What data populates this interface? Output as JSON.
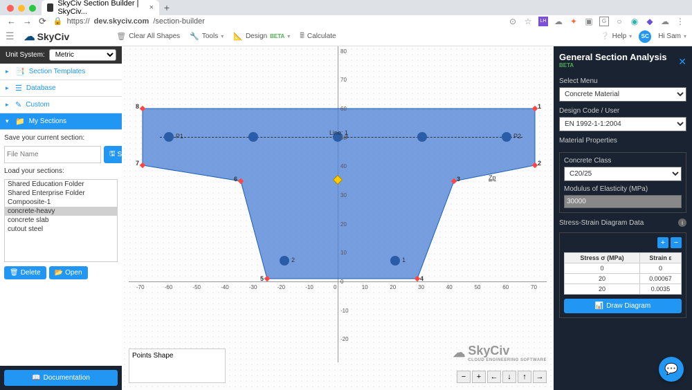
{
  "browser": {
    "tab_title": "SkyCiv Section Builder | SkyCiv...",
    "url_prefix": "https://",
    "url_host": "dev.skyciv.com",
    "url_path": "/section-builder"
  },
  "toolbar": {
    "logo": "SkyCiv",
    "clear": "Clear All Shapes",
    "tools": "Tools",
    "design": "Design",
    "beta": "BETA",
    "calculate": "Calculate",
    "help": "Help",
    "user_initials": "SC",
    "user_name": "Hi Sam"
  },
  "left": {
    "unit_label": "Unit System:",
    "unit_value": "Metric",
    "acc": [
      {
        "label": "Section Templates",
        "icon": "📑"
      },
      {
        "label": "Database",
        "icon": "☰"
      },
      {
        "label": "Custom",
        "icon": "✎"
      },
      {
        "label": "My Sections",
        "icon": "📁"
      }
    ],
    "save_label": "Save your current section:",
    "file_placeholder": "File Name",
    "save_btn": "Save",
    "load_label": "Load your sections:",
    "sections": [
      "Shared Education Folder",
      "Shared Enterprise Folder",
      "Compoosite-1",
      "concrete-heavy",
      "concrete slab",
      "cutout steel"
    ],
    "selected_section": "concrete-heavy",
    "delete_btn": "Delete",
    "open_btn": "Open",
    "doc_btn": "Documentation"
  },
  "canvas": {
    "shape_info": "Points Shape",
    "watermark": "SkyCiv",
    "watermark_sub": "CLOUD ENGINEERING SOFTWARE",
    "xticks": [
      "-70",
      "-60",
      "-50",
      "-40",
      "-30",
      "-20",
      "-10",
      "0",
      "10",
      "20",
      "30",
      "40",
      "50",
      "60",
      "70"
    ],
    "yticks": [
      "80",
      "70",
      "60",
      "50",
      "40",
      "30",
      "20",
      "10",
      "0",
      "-10",
      "-20"
    ],
    "vertices": [
      "1",
      "2",
      "3",
      "4",
      "5",
      "6",
      "7",
      "8"
    ],
    "rebars": [
      "P1",
      "P2",
      "1",
      "2",
      "3"
    ],
    "line_label": "Line: 1",
    "zp": "Zp"
  },
  "right": {
    "title": "General Section Analysis",
    "beta": "BETA",
    "menu_label": "Select Menu",
    "menu_value": "Concrete Material",
    "code_label": "Design Code / User",
    "code_value": "EN 1992-1-1:2004",
    "mat_header": "Material Properties",
    "class_label": "Concrete Class",
    "class_value": "C20/25",
    "modulus_label": "Modulus of Elasticity (MPa)",
    "modulus_value": "30000",
    "ss_header": "Stress-Strain Diagram Data",
    "ss_cols": [
      "Stress σ (MPa)",
      "Strain ε"
    ],
    "ss_rows": [
      [
        "0",
        "0"
      ],
      [
        "20",
        "0.00067"
      ],
      [
        "20",
        "0.0035"
      ]
    ],
    "draw_btn": "Draw Diagram"
  },
  "chart_data": {
    "type": "table",
    "title": "Stress-Strain Diagram Data",
    "columns": [
      "Stress σ (MPa)",
      "Strain ε"
    ],
    "rows": [
      [
        0,
        0
      ],
      [
        20,
        0.00067
      ],
      [
        20,
        0.0035
      ]
    ]
  }
}
